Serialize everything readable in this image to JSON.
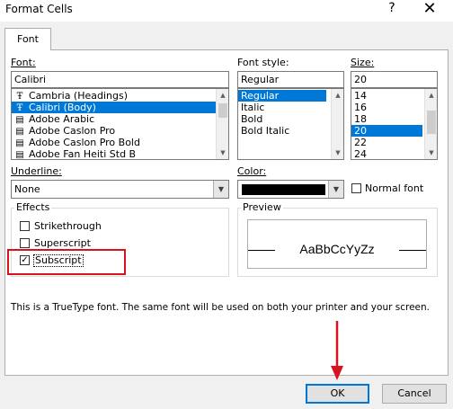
{
  "window": {
    "title": "Format Cells",
    "help_glyph": "?",
    "close_glyph": "✕"
  },
  "tabs": [
    {
      "label": "Font"
    }
  ],
  "font": {
    "label": "Font:",
    "value": "Calibri",
    "items": [
      {
        "label": "Cambria (Headings)",
        "icon": "truetype-font-icon",
        "selected": false
      },
      {
        "label": "Calibri (Body)",
        "icon": "truetype-font-icon",
        "selected": true
      },
      {
        "label": "Adobe Arabic",
        "icon": "opentype-font-icon",
        "selected": false
      },
      {
        "label": "Adobe Caslon Pro",
        "icon": "opentype-font-icon",
        "selected": false
      },
      {
        "label": "Adobe Caslon Pro Bold",
        "icon": "opentype-font-icon",
        "selected": false
      },
      {
        "label": "Adobe Fan Heiti Std B",
        "icon": "opentype-font-icon",
        "selected": false
      }
    ]
  },
  "font_style": {
    "label": "Font style:",
    "value": "Regular",
    "items": [
      {
        "label": "Regular",
        "selected": true
      },
      {
        "label": "Italic",
        "selected": false
      },
      {
        "label": "Bold",
        "selected": false
      },
      {
        "label": "Bold Italic",
        "selected": false
      }
    ]
  },
  "size": {
    "label": "Size:",
    "value": "20",
    "items": [
      {
        "label": "14",
        "selected": false
      },
      {
        "label": "16",
        "selected": false
      },
      {
        "label": "18",
        "selected": false
      },
      {
        "label": "20",
        "selected": true
      },
      {
        "label": "22",
        "selected": false
      },
      {
        "label": "24",
        "selected": false
      }
    ]
  },
  "underline": {
    "label": "Underline:",
    "value": "None"
  },
  "color": {
    "label": "Color:",
    "swatch": "#000000",
    "normal_font_label": "Normal font",
    "normal_font_checked": false
  },
  "effects": {
    "label": "Effects",
    "strikethrough": {
      "label": "Strikethrough",
      "checked": false
    },
    "superscript": {
      "label": "Superscript",
      "checked": false
    },
    "subscript": {
      "label": "Subscript",
      "checked": true
    }
  },
  "preview": {
    "label": "Preview",
    "sample": "AaBbCcYyZz"
  },
  "info_text": "This is a TrueType font.  The same font will be used on both your printer and your screen.",
  "buttons": {
    "ok": "OK",
    "cancel": "Cancel"
  },
  "annotation": {
    "color": "#d9121f"
  }
}
